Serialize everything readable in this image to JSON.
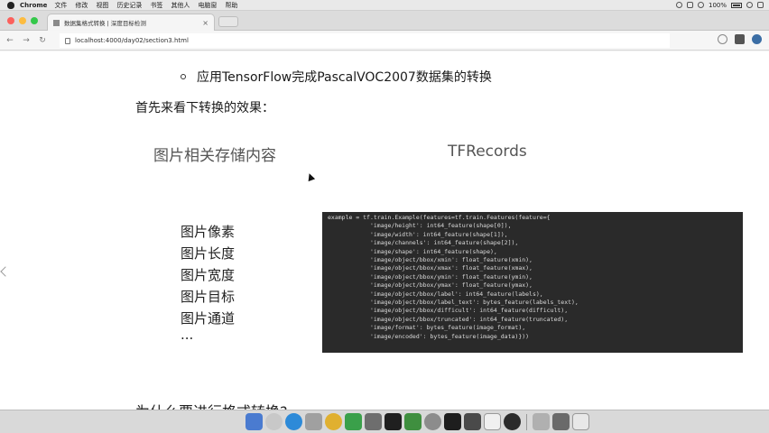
{
  "menubar": {
    "app_name": "Chrome",
    "items": [
      "文件",
      "修改",
      "视图",
      "历史记录",
      "书签",
      "其他人",
      "电脑窗",
      "帮助"
    ],
    "battery": "100%"
  },
  "browser": {
    "tab_title": "数据集格式转换 | 深度目标检测",
    "tab_close": "×",
    "url": "localhost:4000/day02/section3.html"
  },
  "page": {
    "bullet_text": "应用TensorFlow完成PascalVOC2007数据集的转换",
    "intro": "首先来看下转换的效果：",
    "col_left_heading": "图片相关存储内容",
    "col_right_heading": "TFRecords",
    "attributes": [
      "图片像素",
      "图片长度",
      "图片宽度",
      "图片目标",
      "图片通道",
      "..."
    ],
    "code_lines": [
      "example = tf.train.Example(features=tf.train.Features(feature={",
      "            'image/height': int64_feature(shape[0]),",
      "            'image/width': int64_feature(shape[1]),",
      "            'image/channels': int64_feature(shape[2]),",
      "            'image/shape': int64_feature(shape),",
      "            'image/object/bbox/xmin': float_feature(xmin),",
      "            'image/object/bbox/xmax': float_feature(xmax),",
      "            'image/object/bbox/ymin': float_feature(ymin),",
      "            'image/object/bbox/ymax': float_feature(ymax),",
      "            'image/object/bbox/label': int64_feature(labels),",
      "            'image/object/bbox/label_text': bytes_feature(labels_text),",
      "            'image/object/bbox/difficult': int64_feature(difficult),",
      "            'image/object/bbox/truncated': int64_feature(truncated),",
      "            'image/format': bytes_feature(image_format),",
      "            'image/encoded': bytes_feature(image_data)}))"
    ],
    "bottom_heading": "为什么要进行格式转换?"
  },
  "colors": {
    "code_bg": "#2a2a2a",
    "close_light": "#fc605c",
    "min_light": "#fdbc40",
    "max_light": "#34c84a"
  }
}
